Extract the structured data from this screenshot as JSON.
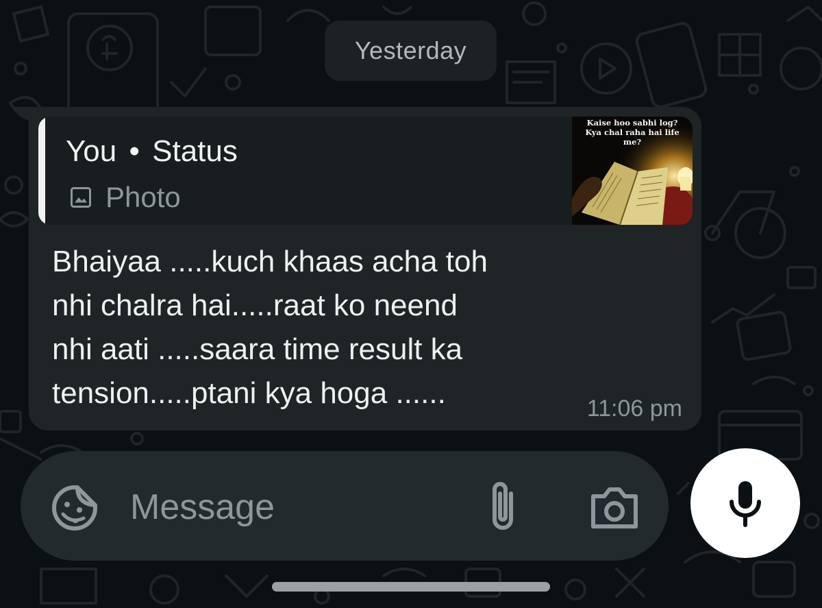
{
  "chat": {
    "date_label": "Yesterday",
    "message": {
      "quoted": {
        "sender": "You",
        "separator": "•",
        "source": "Status",
        "media_type": "Photo",
        "thumbnail_caption": "Kaise hoo sabhi log?\nKya chal raha hai life\nme?"
      },
      "text": "Bhaiyaa .....kuch khaas acha toh\nnhi chalra hai.....raat ko neend\nnhi aati .....saara time result ka\ntension.....ptani kya hoga ......",
      "time": "11:06 pm"
    }
  },
  "composer": {
    "placeholder": "Message",
    "icons": {
      "emoji": "sticker-emoji-icon",
      "attach": "paperclip-icon",
      "camera": "camera-icon",
      "mic": "microphone-icon"
    }
  },
  "colors": {
    "background": "#0b1014",
    "bubble": "#1f2527",
    "quote_bg": "#181d20",
    "composer": "#232a2d",
    "muted_text": "#8e969a",
    "primary_text": "#eef0f1"
  }
}
